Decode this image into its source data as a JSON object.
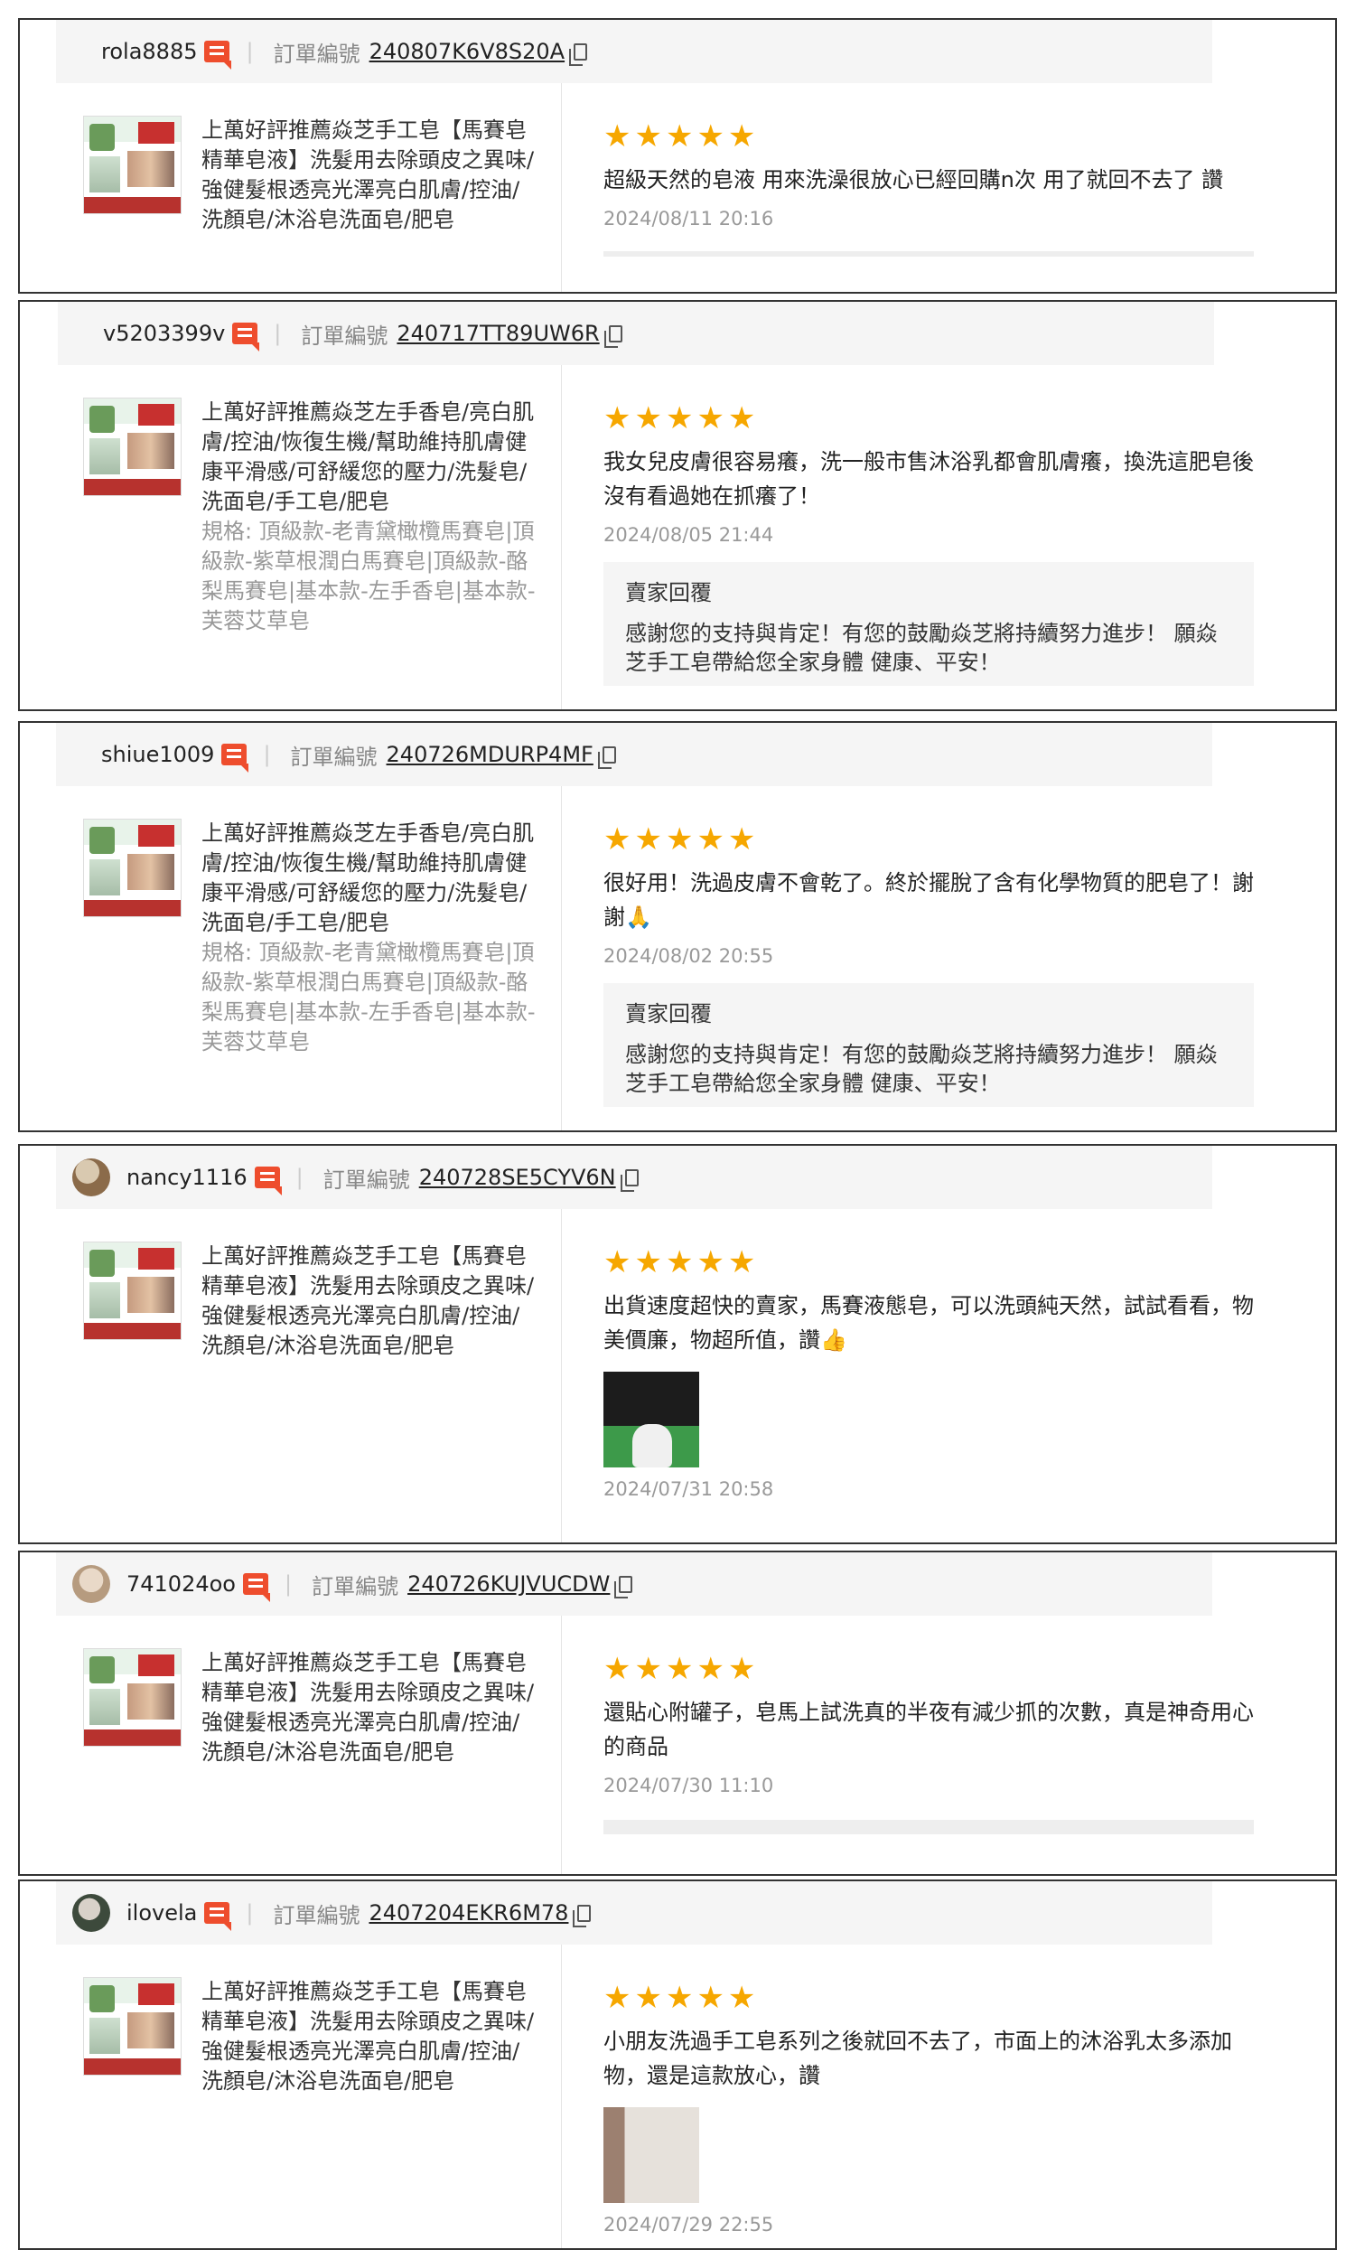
{
  "labels": {
    "order_label": "訂單編號",
    "seller_reply_title": "賣家回覆"
  },
  "colors": {
    "star": "#f6a700",
    "chat_badge": "#ee4d2d"
  },
  "reviews": [
    {
      "username": "rola8885",
      "order_no": "240807K6V8S20A",
      "has_avatar": false,
      "product": "上萬好評推薦焱芝手工皂【馬賽皂精華皂液】洗髮用去除頭皮之異味/強健髮根透亮光澤亮白肌膚/控油/洗顏皂/沐浴皂洗面皂/肥皂",
      "variant": "",
      "rating": 5,
      "text": "超級天然的皂液 用來洗澡很放心已經回購n次 用了就回不去了 讚",
      "date": "2024/08/11 20:16",
      "reply": ""
    },
    {
      "username": "v5203399v",
      "order_no": "240717TT89UW6R",
      "has_avatar": false,
      "product": "上萬好評推薦焱芝左手香皂/亮白肌膚/控油/恢復生機/幫助維持肌膚健康平滑感/可舒緩您的壓力/洗髮皂/洗面皂/手工皂/肥皂",
      "variant": "規格: 頂級款-老青黛橄欖馬賽皂|頂級款-紫草根潤白馬賽皂|頂級款-酪梨馬賽皂|基本款-左手香皂|基本款-芙蓉艾草皂",
      "rating": 5,
      "text": "我女兒皮膚很容易癢，洗一般市售沐浴乳都會肌膚癢，換洗這肥皂後沒有看過她在抓癢了！",
      "date": "2024/08/05 21:44",
      "reply": "感謝您的支持與肯定！有您的鼓勵焱芝將持續努力進步！ 願焱芝手工皂帶給您全家身體 健康、平安！"
    },
    {
      "username": "shiue1009",
      "order_no": "240726MDURP4MF",
      "has_avatar": false,
      "product": "上萬好評推薦焱芝左手香皂/亮白肌膚/控油/恢復生機/幫助維持肌膚健康平滑感/可舒緩您的壓力/洗髮皂/洗面皂/手工皂/肥皂",
      "variant": "規格: 頂級款-老青黛橄欖馬賽皂|頂級款-紫草根潤白馬賽皂|頂級款-酪梨馬賽皂|基本款-左手香皂|基本款-芙蓉艾草皂",
      "rating": 5,
      "text": "很好用！洗過皮膚不會乾了。終於擺脫了含有化學物質的肥皂了！謝謝🙏",
      "date": "2024/08/02 20:55",
      "reply": "感謝您的支持與肯定！有您的鼓勵焱芝將持續努力進步！ 願焱芝手工皂帶給您全家身體 健康、平安！"
    },
    {
      "username": "nancy1116",
      "order_no": "240728SE5CYV6N",
      "has_avatar": true,
      "product": "上萬好評推薦焱芝手工皂【馬賽皂精華皂液】洗髮用去除頭皮之異味/強健髮根透亮光澤亮白肌膚/控油/洗顏皂/沐浴皂洗面皂/肥皂",
      "variant": "",
      "rating": 5,
      "text": "出貨速度超快的賣家，馬賽液態皂，可以洗頭純天然，試試看看，物美價廉，物超所值，讚👍",
      "date": "2024/07/31 20:58",
      "reply": ""
    },
    {
      "username": "741024oo",
      "order_no": "240726KUJVUCDW",
      "has_avatar": true,
      "product": "上萬好評推薦焱芝手工皂【馬賽皂精華皂液】洗髮用去除頭皮之異味/強健髮根透亮光澤亮白肌膚/控油/洗顏皂/沐浴皂洗面皂/肥皂",
      "variant": "",
      "rating": 5,
      "text": "還貼心附罐子，皂馬上試洗真的半夜有減少抓的次數，真是神奇用心的商品",
      "date": "2024/07/30 11:10",
      "reply": ""
    },
    {
      "username": "ilovela",
      "order_no": "2407204EKR6M78",
      "has_avatar": true,
      "product": "上萬好評推薦焱芝手工皂【馬賽皂精華皂液】洗髮用去除頭皮之異味/強健髮根透亮光澤亮白肌膚/控油/洗顏皂/沐浴皂洗面皂/肥皂",
      "variant": "",
      "rating": 5,
      "text": "小朋友洗過手工皂系列之後就回不去了，市面上的沐浴乳太多添加物，還是這款放心，讚",
      "date": "2024/07/29 22:55",
      "reply": ""
    }
  ]
}
